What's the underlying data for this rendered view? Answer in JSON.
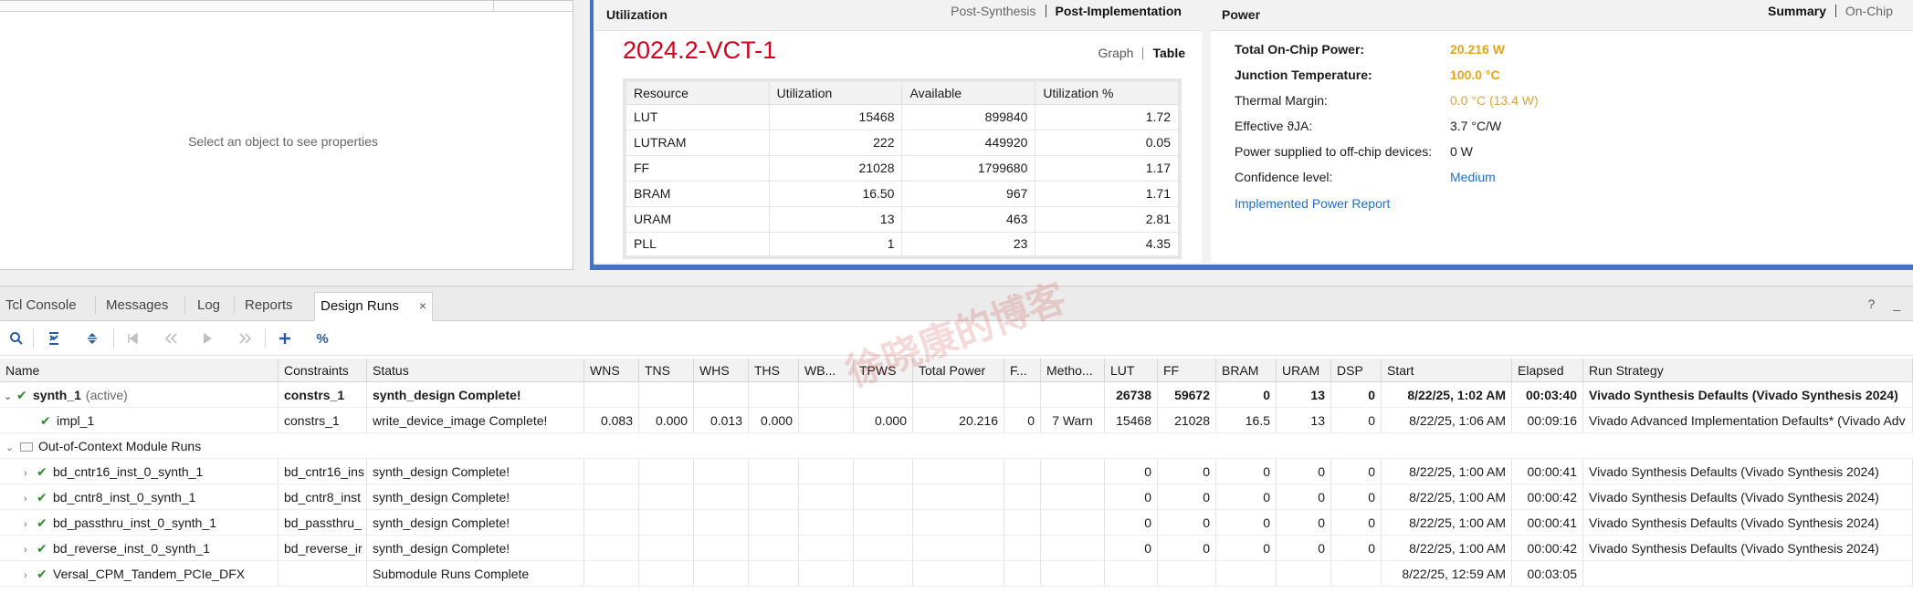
{
  "properties_panel": {
    "message": "Select an object to see properties"
  },
  "utilization": {
    "title": "Utilization",
    "tabs": [
      "Post-Synthesis",
      "Post-Implementation"
    ],
    "active_tab": "Post-Implementation",
    "device": "2024.2-VCT-1",
    "view_tabs": [
      "Graph",
      "Table"
    ],
    "active_view": "Table",
    "columns": [
      "Resource",
      "Utilization",
      "Available",
      "Utilization %"
    ],
    "rows": [
      [
        "LUT",
        "15468",
        "899840",
        "1.72"
      ],
      [
        "LUTRAM",
        "222",
        "449920",
        "0.05"
      ],
      [
        "FF",
        "21028",
        "1799680",
        "1.17"
      ],
      [
        "BRAM",
        "16.50",
        "967",
        "1.71"
      ],
      [
        "URAM",
        "13",
        "463",
        "2.81"
      ],
      [
        "PLL",
        "1",
        "23",
        "4.35"
      ]
    ]
  },
  "power": {
    "title": "Power",
    "tabs": [
      "Summary",
      "On-Chip"
    ],
    "active_tab": "Summary",
    "rows": [
      {
        "label": "Total On-Chip Power:",
        "value": "20.216 W"
      },
      {
        "label": "Junction Temperature:",
        "value": "100.0 °C"
      },
      {
        "label": "Thermal Margin:",
        "value": "0.0 °C (13.4 W)"
      },
      {
        "label": "Effective ϑJA:",
        "value": "3.7 °C/W"
      },
      {
        "label": "Power supplied to off-chip devices:",
        "value": "0 W"
      },
      {
        "label": "Confidence level:",
        "value": "Medium"
      }
    ],
    "report_link": "Implemented Power Report"
  },
  "bottom_tabs": {
    "items": [
      "Tcl Console",
      "Messages",
      "Log",
      "Reports",
      "Design Runs"
    ],
    "active": "Design Runs",
    "close_glyph": "×",
    "window_controls": "? _"
  },
  "toolbar_icons": [
    "search-icon",
    "collapse-all-icon",
    "expand-all-icon",
    "first-icon",
    "previous-icon",
    "run-icon",
    "next-icon",
    "add-icon",
    "percent-icon"
  ],
  "toolbar_glyphs": {
    "percent": "%"
  },
  "design_runs": {
    "columns": [
      "Name",
      "Constraints",
      "Status",
      "WNS",
      "TNS",
      "WHS",
      "THS",
      "WB...",
      "TPWS",
      "Total Power",
      "F...",
      "Metho...",
      "LUT",
      "FF",
      "BRAM",
      "URAM",
      "DSP",
      "Start",
      "Elapsed",
      "Run Strategy"
    ],
    "rows": [
      {
        "name": "synth_1",
        "suffix": "(active)",
        "constraints": "constrs_1",
        "status": "synth_design Complete!",
        "wns": "",
        "tns": "",
        "whs": "",
        "ths": "",
        "wbss": "",
        "tpws": "",
        "total_power": "",
        "failed": "",
        "methodology": "",
        "lut": "26738",
        "ff": "59672",
        "bram": "0",
        "uram": "13",
        "dsp": "0",
        "start": "8/22/25, 1:02 AM",
        "elapsed": "00:03:40",
        "strategy": "Vivado Synthesis Defaults (Vivado Synthesis 2024)"
      },
      {
        "name": "impl_1",
        "suffix": "",
        "constraints": "constrs_1",
        "status": "write_device_image Complete!",
        "wns": "0.083",
        "tns": "0.000",
        "whs": "0.013",
        "ths": "0.000",
        "wbss": "",
        "tpws": "0.000",
        "total_power": "20.216",
        "failed": "0",
        "methodology": "7 Warn",
        "lut": "15468",
        "ff": "21028",
        "bram": "16.5",
        "uram": "13",
        "dsp": "0",
        "start": "8/22/25, 1:06 AM",
        "elapsed": "00:09:16",
        "strategy": "Vivado Advanced Implementation Defaults* (Vivado Adv"
      },
      {
        "group": "Out-of-Context Module Runs"
      },
      {
        "name": "bd_cntr16_inst_0_synth_1",
        "suffix": "",
        "constraints": "bd_cntr16_ins",
        "status": "synth_design Complete!",
        "wns": "",
        "tns": "",
        "whs": "",
        "ths": "",
        "wbss": "",
        "tpws": "",
        "total_power": "",
        "failed": "",
        "methodology": "",
        "lut": "0",
        "ff": "0",
        "bram": "0",
        "uram": "0",
        "dsp": "0",
        "start": "8/22/25, 1:00 AM",
        "elapsed": "00:00:41",
        "strategy": "Vivado Synthesis Defaults (Vivado Synthesis 2024)"
      },
      {
        "name": "bd_cntr8_inst_0_synth_1",
        "suffix": "",
        "constraints": "bd_cntr8_inst",
        "status": "synth_design Complete!",
        "wns": "",
        "tns": "",
        "whs": "",
        "ths": "",
        "wbss": "",
        "tpws": "",
        "total_power": "",
        "failed": "",
        "methodology": "",
        "lut": "0",
        "ff": "0",
        "bram": "0",
        "uram": "0",
        "dsp": "0",
        "start": "8/22/25, 1:00 AM",
        "elapsed": "00:00:42",
        "strategy": "Vivado Synthesis Defaults (Vivado Synthesis 2024)"
      },
      {
        "name": "bd_passthru_inst_0_synth_1",
        "suffix": "",
        "constraints": "bd_passthru_",
        "status": "synth_design Complete!",
        "wns": "",
        "tns": "",
        "whs": "",
        "ths": "",
        "wbss": "",
        "tpws": "",
        "total_power": "",
        "failed": "",
        "methodology": "",
        "lut": "0",
        "ff": "0",
        "bram": "0",
        "uram": "0",
        "dsp": "0",
        "start": "8/22/25, 1:00 AM",
        "elapsed": "00:00:41",
        "strategy": "Vivado Synthesis Defaults (Vivado Synthesis 2024)"
      },
      {
        "name": "bd_reverse_inst_0_synth_1",
        "suffix": "",
        "constraints": "bd_reverse_ir",
        "status": "synth_design Complete!",
        "wns": "",
        "tns": "",
        "whs": "",
        "ths": "",
        "wbss": "",
        "tpws": "",
        "total_power": "",
        "failed": "",
        "methodology": "",
        "lut": "0",
        "ff": "0",
        "bram": "0",
        "uram": "0",
        "dsp": "0",
        "start": "8/22/25, 1:00 AM",
        "elapsed": "00:00:42",
        "strategy": "Vivado Synthesis Defaults (Vivado Synthesis 2024)"
      },
      {
        "name": "Versal_CPM_Tandem_PCIe_DFX",
        "suffix": "",
        "constraints": "",
        "status": "Submodule Runs Complete",
        "wns": "",
        "tns": "",
        "whs": "",
        "ths": "",
        "wbss": "",
        "tpws": "",
        "total_power": "",
        "failed": "",
        "methodology": "",
        "lut": "",
        "ff": "",
        "bram": "",
        "uram": "",
        "dsp": "",
        "start": "8/22/25, 12:59 AM",
        "elapsed": "00:03:05",
        "strategy": ""
      }
    ]
  },
  "colors": {
    "accent_blue": "#4472c4",
    "device_red": "#d0021b",
    "power_orange": "#e8a317",
    "link_blue": "#1f6fd4",
    "check_green": "#2e8b2e"
  }
}
